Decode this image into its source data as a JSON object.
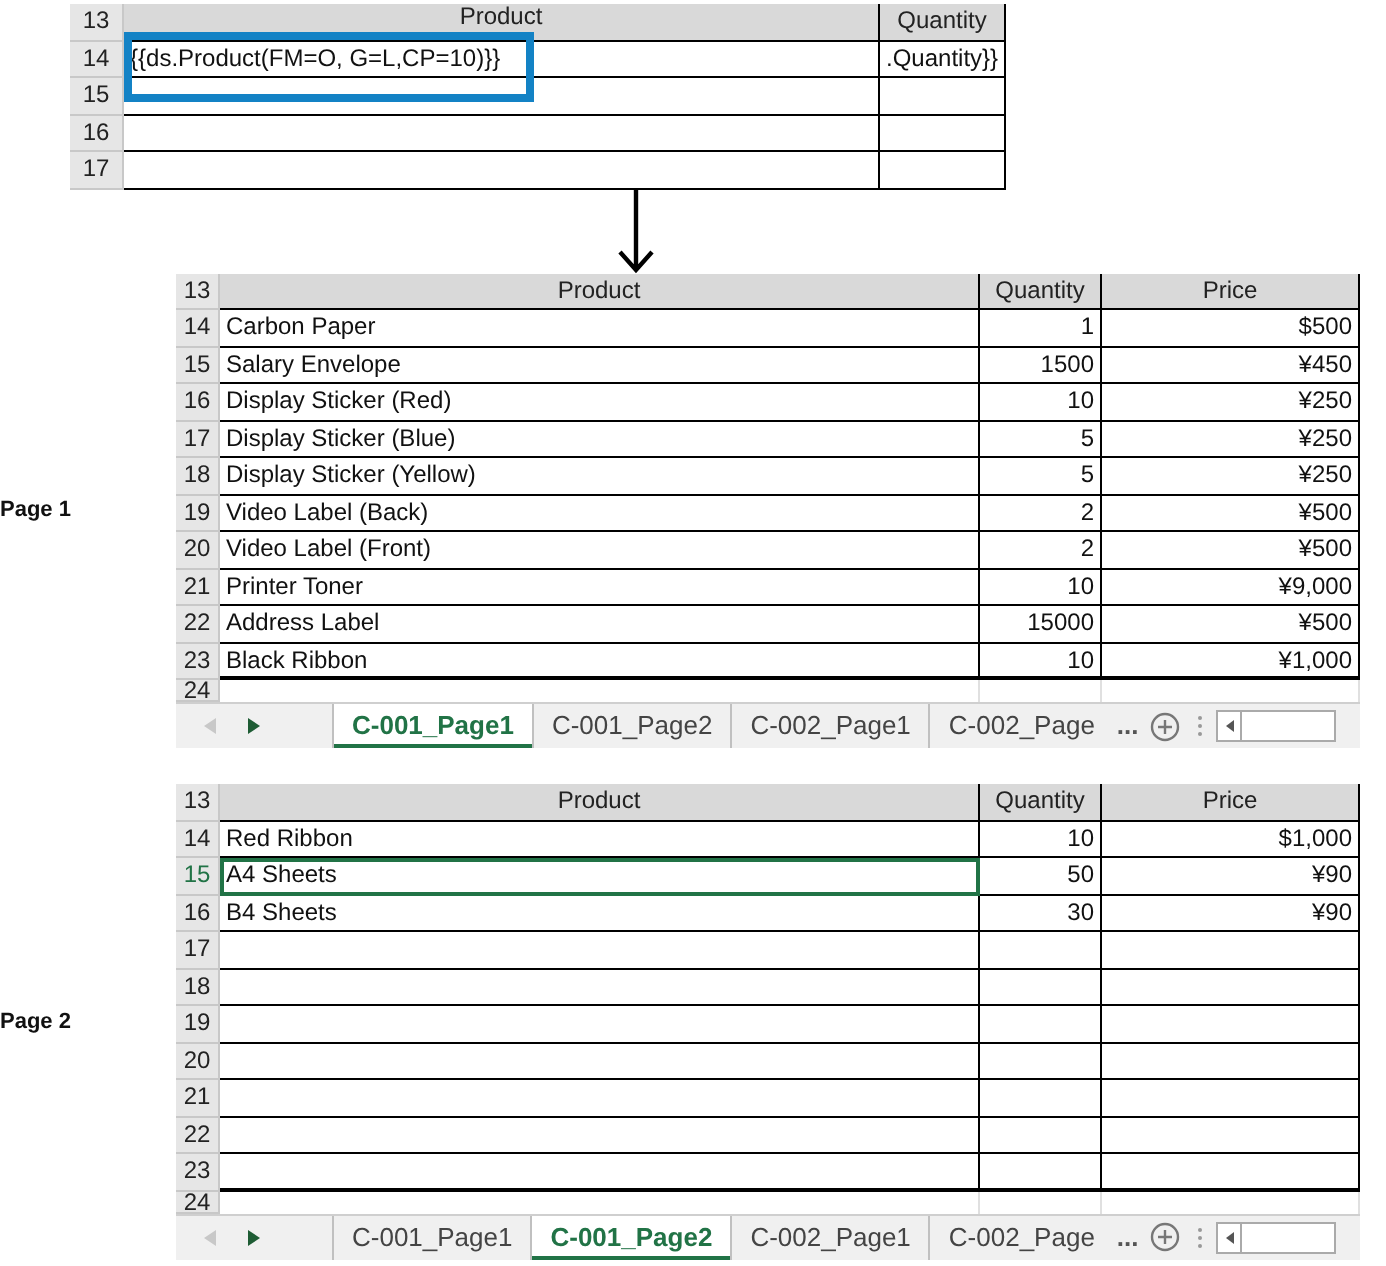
{
  "template": {
    "header_row": "13",
    "columns": [
      "Product",
      "Quantity"
    ],
    "rows": [
      {
        "number": "14",
        "product": "{{ds.Product(FM=O, G=L,CP=10)}}",
        "quantity": ".Quantity}}"
      },
      {
        "number": "15"
      },
      {
        "number": "16"
      },
      {
        "number": "17"
      }
    ]
  },
  "sheets": [
    {
      "label": "Page 1",
      "header_row": "13",
      "columns": [
        "Product",
        "Quantity",
        "Price"
      ],
      "rows": [
        {
          "number": "14",
          "product": "Carbon Paper",
          "quantity": "1",
          "price": "$500",
          "selected": false
        },
        {
          "number": "15",
          "product": "Salary Envelope",
          "quantity": "1500",
          "price": "¥450",
          "selected": false
        },
        {
          "number": "16",
          "product": "Display Sticker (Red)",
          "quantity": "10",
          "price": "¥250",
          "selected": false
        },
        {
          "number": "17",
          "product": "Display Sticker (Blue)",
          "quantity": "5",
          "price": "¥250",
          "selected": false
        },
        {
          "number": "18",
          "product": "Display Sticker (Yellow)",
          "quantity": "5",
          "price": "¥250",
          "selected": false
        },
        {
          "number": "19",
          "product": "Video Label (Back)",
          "quantity": "2",
          "price": "¥500",
          "selected": false
        },
        {
          "number": "20",
          "product": "Video Label (Front)",
          "quantity": "2",
          "price": "¥500",
          "selected": false
        },
        {
          "number": "21",
          "product": "Printer Toner",
          "quantity": "10",
          "price": "¥9,000",
          "selected": false
        },
        {
          "number": "22",
          "product": "Address Label",
          "quantity": "15000",
          "price": "¥500",
          "selected": false
        },
        {
          "number": "23",
          "product": "Black Ribbon",
          "quantity": "10",
          "price": "¥1,000",
          "selected": false
        }
      ],
      "partial_row": "24",
      "tabs": [
        {
          "label": "C-001_Page1",
          "selected": true
        },
        {
          "label": "C-001_Page2",
          "selected": false
        },
        {
          "label": "C-002_Page1",
          "selected": false
        },
        {
          "label": "C-002_Page",
          "selected": false
        }
      ],
      "more_tabs": "..."
    },
    {
      "label": "Page 2",
      "header_row": "13",
      "columns": [
        "Product",
        "Quantity",
        "Price"
      ],
      "rows": [
        {
          "number": "14",
          "product": "Red Ribbon",
          "quantity": "10",
          "price": "$1,000",
          "selected": false
        },
        {
          "number": "15",
          "product": "A4 Sheets",
          "quantity": "50",
          "price": "¥90",
          "selected": true
        },
        {
          "number": "16",
          "product": "B4 Sheets",
          "quantity": "30",
          "price": "¥90",
          "selected": false
        },
        {
          "number": "17",
          "selected": false
        },
        {
          "number": "18",
          "selected": false
        },
        {
          "number": "19",
          "selected": false
        },
        {
          "number": "20",
          "selected": false
        },
        {
          "number": "21",
          "selected": false
        },
        {
          "number": "22",
          "selected": false
        },
        {
          "number": "23",
          "selected": false
        }
      ],
      "partial_row": "24",
      "tabs": [
        {
          "label": "C-001_Page1",
          "selected": false
        },
        {
          "label": "C-001_Page2",
          "selected": true
        },
        {
          "label": "C-002_Page1",
          "selected": false
        },
        {
          "label": "C-002_Page",
          "selected": false
        }
      ],
      "more_tabs": "..."
    }
  ]
}
